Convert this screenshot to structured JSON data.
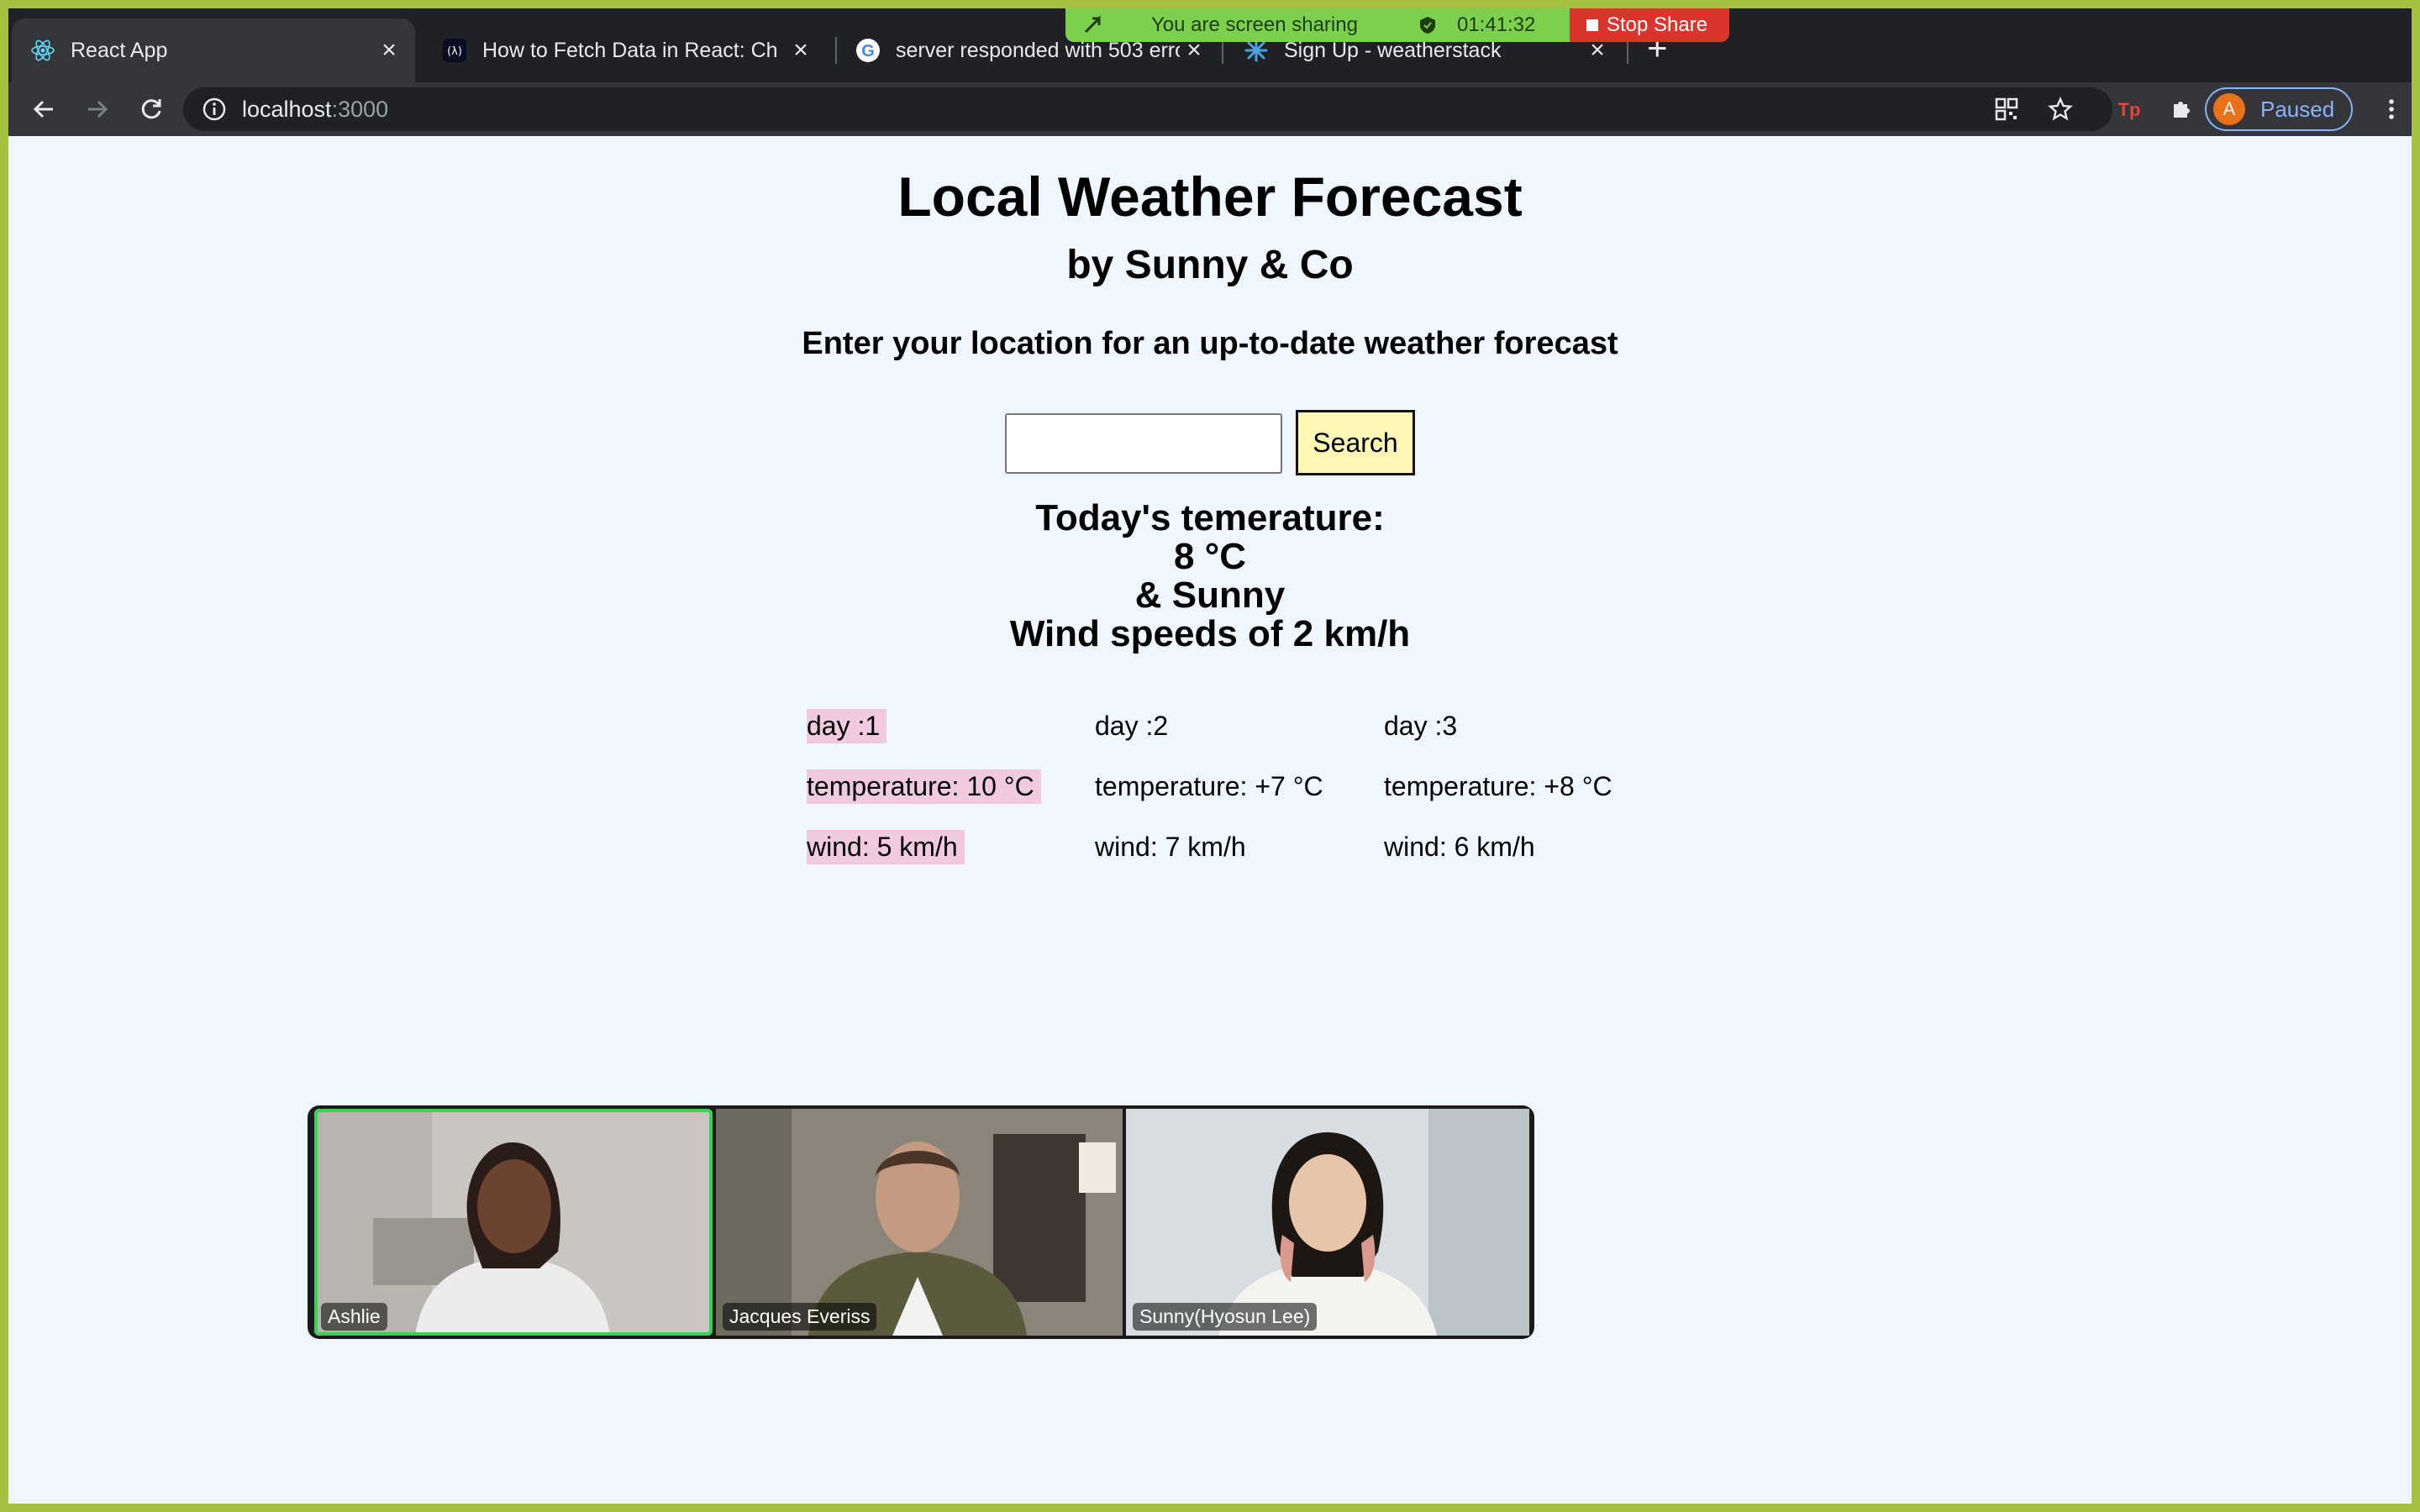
{
  "browser": {
    "tabs": [
      {
        "title": "React App",
        "active": true,
        "favicon": "react-icon"
      },
      {
        "title": "How to Fetch Data in React: Ch",
        "active": false,
        "favicon": "freecodecamp-icon"
      },
      {
        "title": "server responded with 503 erro",
        "active": false,
        "favicon": "google-icon"
      },
      {
        "title": "Sign Up - weatherstack",
        "active": false,
        "favicon": "weatherstack-icon"
      }
    ],
    "url_host": "localhost",
    "url_port": ":3000",
    "profile_initial": "A",
    "profile_status": "Paused"
  },
  "share_banner": {
    "message": "You are screen sharing",
    "timer": "01:41:32",
    "stop_label": "Stop Share"
  },
  "app": {
    "title": "Local Weather Forecast",
    "subtitle": "by Sunny & Co",
    "prompt": "Enter your location for an up-to-date weather forecast",
    "search_value": "",
    "search_button": "Search",
    "today": {
      "heading": "Today's temerature:",
      "temp": "8 °C",
      "condition": "& Sunny",
      "wind": "Wind speeds of 2 km/h"
    },
    "forecast": [
      {
        "day": "day :1",
        "temperature": "temperature: 10 °C",
        "wind": "wind: 5 km/h",
        "highlighted": true
      },
      {
        "day": "day :2",
        "temperature": "temperature: +7 °C",
        "wind": "wind: 7 km/h",
        "highlighted": false
      },
      {
        "day": "day :3",
        "temperature": "temperature: +8 °C",
        "wind": "wind: 6 km/h",
        "highlighted": false
      }
    ]
  },
  "video_call": {
    "participants": [
      {
        "name": "Ashlie",
        "speaking": true
      },
      {
        "name": "Jacques Everiss",
        "speaking": false
      },
      {
        "name": "Sunny(Hyosun Lee)",
        "speaking": false
      }
    ]
  },
  "colors": {
    "page_bg": "#f0f6fe",
    "outer_frame": "#a4c23f",
    "highlight": "#f1cae2",
    "search_button_bg": "#fdf6b5",
    "share_green": "#7cd04e",
    "stop_red": "#d9352d"
  }
}
